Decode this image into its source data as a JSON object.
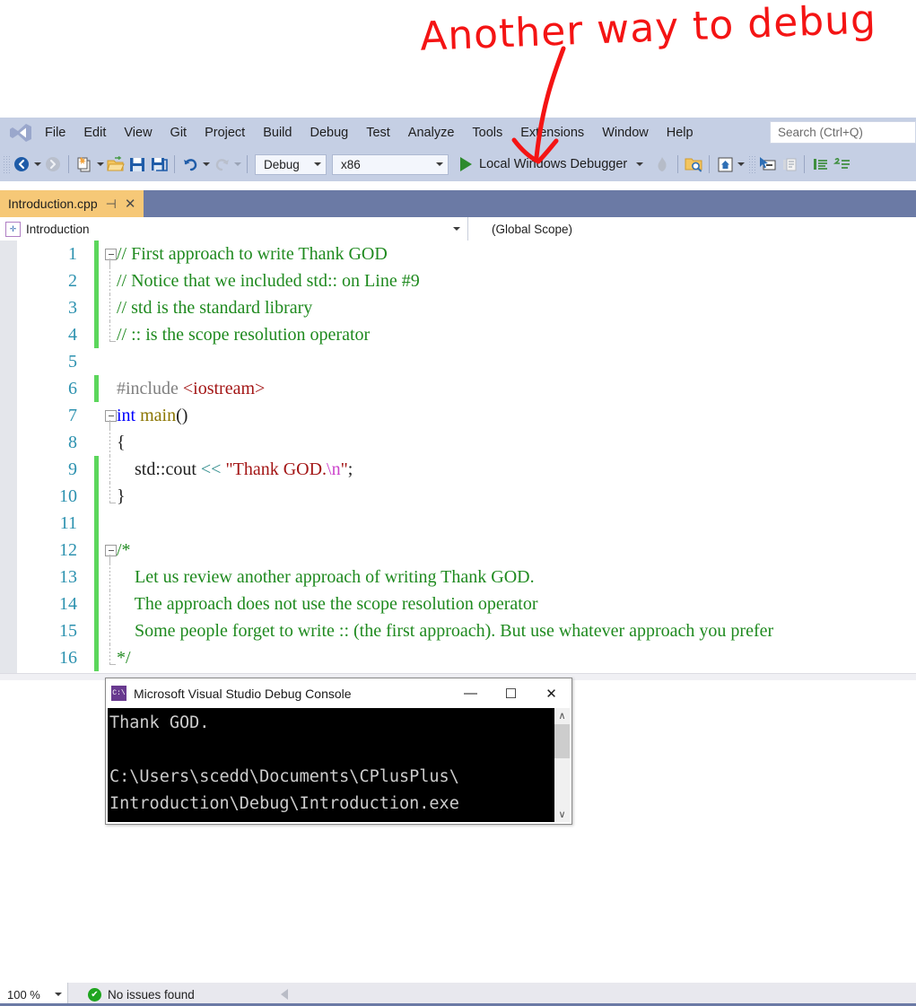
{
  "annotation": {
    "text": "Another way to debug",
    "color": "#f41414",
    "arrow_points_to": "Local Windows Debugger"
  },
  "menubar": {
    "logo": "visual-studio-logo",
    "items": [
      "File",
      "Edit",
      "View",
      "Git",
      "Project",
      "Build",
      "Debug",
      "Test",
      "Analyze",
      "Tools",
      "Extensions",
      "Window",
      "Help"
    ],
    "search_placeholder": "Search (Ctrl+Q)"
  },
  "toolbar": {
    "nav_back": "back-icon",
    "nav_forward": "forward-icon",
    "new_item": "new-item-icon",
    "open_file": "open-folder-icon",
    "save": "save-icon",
    "save_all": "save-all-icon",
    "undo": "undo-icon",
    "redo": "redo-icon",
    "configuration": "Debug",
    "platform": "x86",
    "run_label": "Local Windows Debugger",
    "hot_reload": "hot-reload-icon",
    "find_in_files": "find-in-files-icon",
    "home": "home-icon",
    "cursor_window": "cursor-window-icon",
    "copy_panel": "copy-panel-icon",
    "comment": "comment-icon",
    "uncomment": "uncomment-icon"
  },
  "tab": {
    "title": "Introduction.cpp",
    "pin": "pin-icon",
    "close": "close-icon"
  },
  "scopebar": {
    "project": "Introduction",
    "project_icon": "cpp-file-icon",
    "scope": "(Global Scope)"
  },
  "editor": {
    "lines": [
      {
        "n": "1",
        "changed": true,
        "fold": "start",
        "segments": [
          {
            "t": "// First approach to write Thank GOD",
            "c": "cm"
          }
        ]
      },
      {
        "n": "2",
        "changed": true,
        "fold": "mid",
        "segments": [
          {
            "t": "// Notice that we included std:: on Line #9",
            "c": "cm"
          }
        ]
      },
      {
        "n": "3",
        "changed": true,
        "fold": "mid",
        "segments": [
          {
            "t": "// std is the standard library",
            "c": "cm"
          }
        ]
      },
      {
        "n": "4",
        "changed": true,
        "fold": "end",
        "segments": [
          {
            "t": "// :: is the scope resolution operator",
            "c": "cm"
          }
        ]
      },
      {
        "n": "5",
        "changed": false,
        "fold": "none",
        "segments": []
      },
      {
        "n": "6",
        "changed": true,
        "fold": "none",
        "segments": [
          {
            "t": "#include ",
            "c": "pp"
          },
          {
            "t": "<iostream>",
            "c": "inc"
          }
        ]
      },
      {
        "n": "7",
        "changed": false,
        "fold": "start",
        "segments": [
          {
            "t": "int ",
            "c": "kw"
          },
          {
            "t": "main",
            "c": "fn"
          },
          {
            "t": "()",
            "c": ""
          }
        ]
      },
      {
        "n": "8",
        "changed": false,
        "fold": "mid",
        "segments": [
          {
            "t": "{",
            "c": ""
          }
        ]
      },
      {
        "n": "9",
        "changed": true,
        "fold": "mid",
        "segments": [
          {
            "t": "    std::cout ",
            "c": ""
          },
          {
            "t": "<<",
            "c": "op"
          },
          {
            "t": " ",
            "c": ""
          },
          {
            "t": "\"Thank GOD.",
            "c": "str"
          },
          {
            "t": "\\n",
            "c": "esc"
          },
          {
            "t": "\"",
            "c": "str"
          },
          {
            "t": ";",
            "c": ""
          }
        ]
      },
      {
        "n": "10",
        "changed": true,
        "fold": "end",
        "segments": [
          {
            "t": "}",
            "c": ""
          }
        ]
      },
      {
        "n": "11",
        "changed": true,
        "fold": "none",
        "segments": []
      },
      {
        "n": "12",
        "changed": true,
        "fold": "start",
        "segments": [
          {
            "t": "/*",
            "c": "cm"
          }
        ]
      },
      {
        "n": "13",
        "changed": true,
        "fold": "mid",
        "segments": [
          {
            "t": "    Let us review another approach of writing Thank GOD.",
            "c": "cm"
          }
        ]
      },
      {
        "n": "14",
        "changed": true,
        "fold": "mid",
        "segments": [
          {
            "t": "    The approach does not use the scope resolution operator",
            "c": "cm"
          }
        ]
      },
      {
        "n": "15",
        "changed": true,
        "fold": "mid",
        "segments": [
          {
            "t": "    Some people forget to write :: (the first approach). But use whatever approach you prefer",
            "c": "cm"
          }
        ]
      },
      {
        "n": "16",
        "changed": true,
        "fold": "end",
        "segments": [
          {
            "t": "*/",
            "c": "cm"
          }
        ]
      }
    ]
  },
  "console": {
    "title": "Microsoft Visual Studio Debug Console",
    "icon": "console-icon",
    "minimize": "minimize-icon",
    "maximize": "maximize-icon",
    "close": "close-icon",
    "output": "Thank GOD.\n\nC:\\Users\\scedd\\Documents\\CPlusPlus\\\nIntroduction\\Debug\\Introduction.exe",
    "scroll_up": "chevron-up-icon",
    "scroll_down": "chevron-down-icon"
  },
  "statusbar": {
    "zoom": "100 %",
    "issues": "No issues found",
    "issues_icon": "check-circle-icon",
    "nav_triangle": "triangle-left-icon"
  },
  "colors": {
    "chrome": "#c5cfe4",
    "tab_active": "#f6c877",
    "tabstrip": "#6b7aa5",
    "change_bar": "#5cd65c",
    "comment": "#1f8a1f",
    "keyword": "#0000ff",
    "string": "#a31515",
    "line_number": "#2b91af",
    "annotation": "#f41414"
  }
}
